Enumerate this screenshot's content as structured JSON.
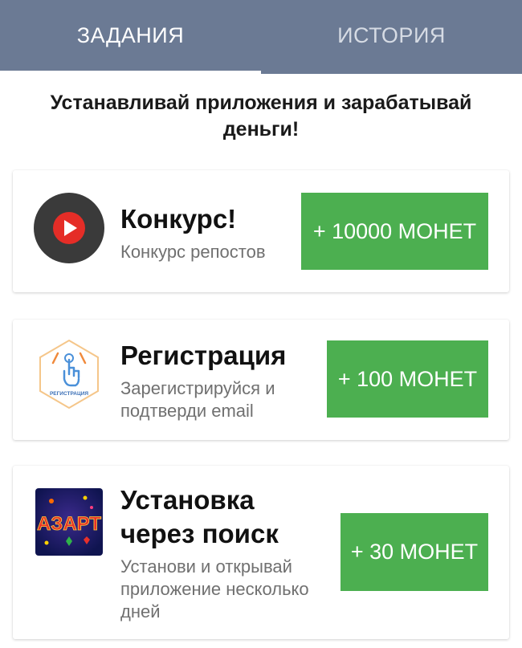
{
  "tabs": {
    "tasks": "ЗАДАНИЯ",
    "history": "ИСТОРИЯ",
    "active": "tasks"
  },
  "headline": "Устанавливай приложения и зарабатывай деньги!",
  "tasks": [
    {
      "icon": "youtube-play-icon",
      "title": "Конкурс!",
      "description": "Конкурс репостов",
      "reward": "+ 10000 МОНЕТ"
    },
    {
      "icon": "registration-hand-icon",
      "icon_caption": "РЕГИСТРАЦИЯ",
      "title": "Регистрация",
      "description": "Зарегистрируйся и подтверди email",
      "reward": "+ 100 МОНЕТ"
    },
    {
      "icon": "azart-app-icon",
      "icon_caption": "АЗАРТ",
      "title": "Установка через поиск",
      "description": "Установи и открывай приложение несколько дней",
      "reward": "+ 30 МОНЕТ"
    }
  ],
  "colors": {
    "tab_bar": "#6b7a94",
    "button": "#4caf50",
    "title": "#111111",
    "description": "#707070"
  }
}
